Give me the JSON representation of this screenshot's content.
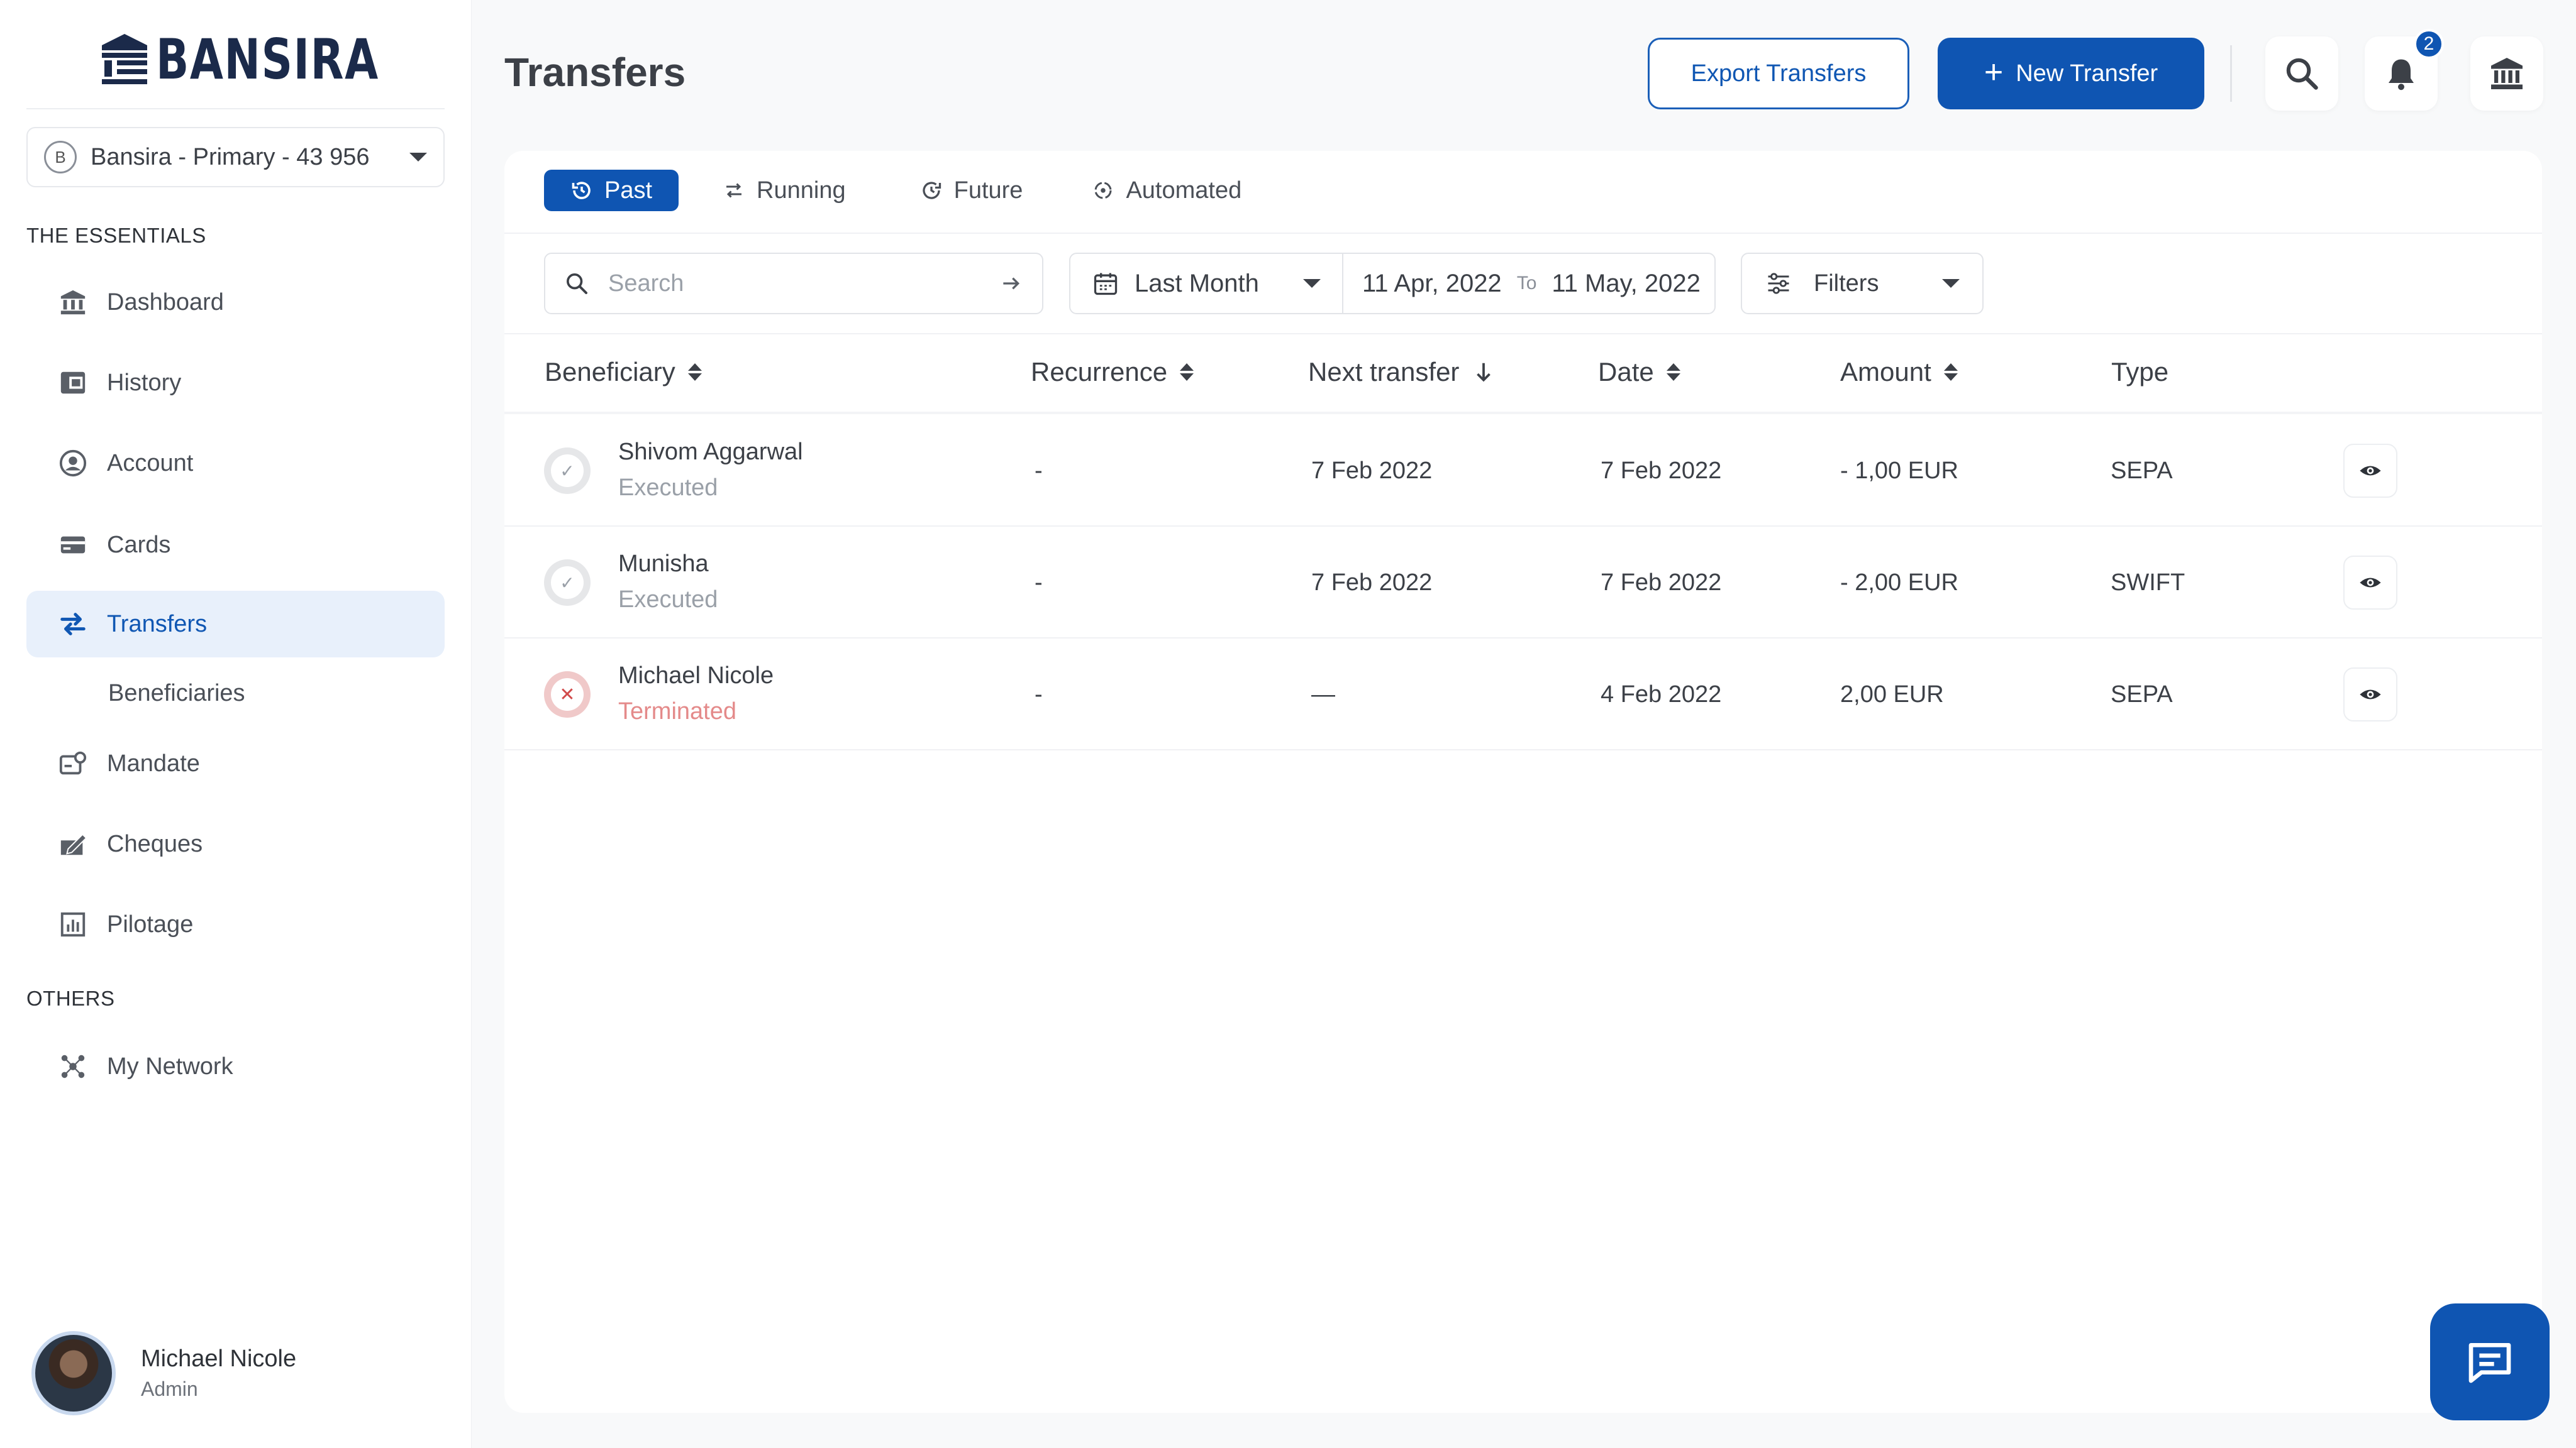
{
  "app": {
    "brand": "BANSIRA"
  },
  "sidebar": {
    "account_selector": {
      "initial": "B",
      "label": "Bansira - Primary - 43 956"
    },
    "section_essentials": "THE ESSENTIALS",
    "items": [
      {
        "label": "Dashboard",
        "icon": "bank-icon"
      },
      {
        "label": "History",
        "icon": "history-icon"
      },
      {
        "label": "Account",
        "icon": "account-icon"
      },
      {
        "label": "Cards",
        "icon": "card-icon"
      },
      {
        "label": "Transfers",
        "icon": "transfer-icon",
        "active": true
      },
      {
        "label": "Beneficiaries",
        "icon": ""
      },
      {
        "label": "Mandate",
        "icon": "mandate-icon"
      },
      {
        "label": "Cheques",
        "icon": "cheque-icon"
      },
      {
        "label": "Pilotage",
        "icon": "chart-icon"
      }
    ],
    "section_others": "OTHERS",
    "others": [
      {
        "label": "My Network",
        "icon": "network-icon"
      }
    ],
    "user": {
      "name": "Michael Nicole",
      "role": "Admin"
    }
  },
  "header": {
    "title": "Transfers",
    "export_label": "Export Transfers",
    "new_transfer_label": "New Transfer",
    "notification_count": "2"
  },
  "tabs": [
    {
      "label": "Past",
      "active": true
    },
    {
      "label": "Running"
    },
    {
      "label": "Future"
    },
    {
      "label": "Automated"
    }
  ],
  "filters": {
    "search_placeholder": "Search",
    "range_label": "Last Month",
    "date_from": "11 Apr, 2022",
    "date_to_label": "To",
    "date_to": "11 May, 2022",
    "filters_label": "Filters"
  },
  "table": {
    "columns": [
      "Beneficiary",
      "Recurrence",
      "Next transfer",
      "Date",
      "Amount",
      "Type"
    ],
    "rows": [
      {
        "name": "Shivom Aggarwal",
        "status": "Executed",
        "recurrence": "-",
        "next_transfer": "7 Feb 2022",
        "date": "7 Feb 2022",
        "amount": "- 1,00 EUR",
        "type": "SEPA"
      },
      {
        "name": "Munisha",
        "status": "Executed",
        "recurrence": "-",
        "next_transfer": "7 Feb 2022",
        "date": "7 Feb 2022",
        "amount": "- 2,00 EUR",
        "type": "SWIFT"
      },
      {
        "name": "Michael Nicole",
        "status": "Terminated",
        "recurrence": "-",
        "next_transfer": "—",
        "date": "4 Feb 2022",
        "amount": "2,00 EUR",
        "type": "SEPA"
      }
    ]
  },
  "colors": {
    "primary": "#0f55b2",
    "active_nav_bg": "#e8f0fb",
    "terminated_text": "#e48a8a"
  }
}
